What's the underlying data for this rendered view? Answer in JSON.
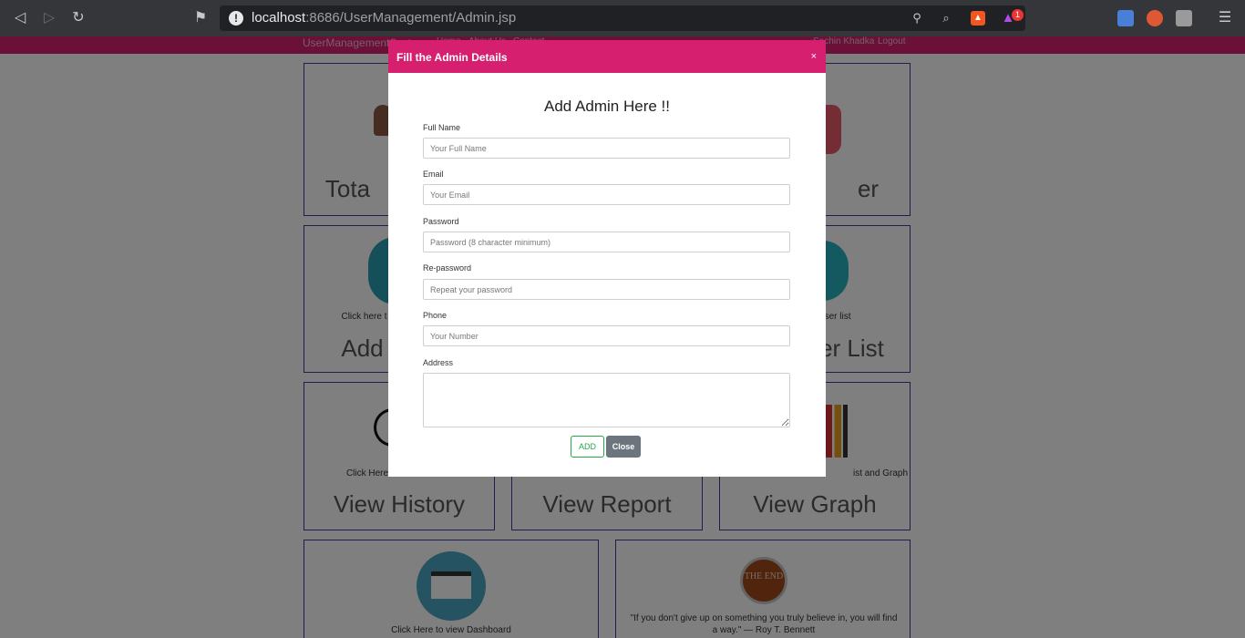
{
  "browser": {
    "url_host": "localhost",
    "url_path": ":8686/UserManagement/Admin.jsp",
    "rewards_badge": "1"
  },
  "navbar": {
    "brand": "UserManagementSystem",
    "links": [
      "Home",
      "About Us",
      "Contact"
    ],
    "user_name": "Sachin Khadka",
    "logout": "Logout"
  },
  "cards": {
    "total_title": "Tota",
    "user_title_fragment": "er",
    "add_sub": "Click here t",
    "add_title": "Add",
    "list_sub": "ew user list",
    "list_title": "er List",
    "history_sub": "Click Here",
    "history_title": "View History",
    "report_title": "View Report",
    "graph_sub": "ist and Graph",
    "graph_title": "View Graph",
    "dashboard_sub": "Click Here to view Dashboard",
    "end_badge": "THE END",
    "quote": "\"If you don't give up on something you truly believe in, you will find a way.\" — Roy T. Bennett"
  },
  "modal": {
    "title": "Fill the Admin Details",
    "close_x": "×",
    "heading": "Add Admin Here !!",
    "fields": {
      "full_name_label": "Full Name",
      "full_name_placeholder": "Your Full Name",
      "email_label": "Email",
      "email_placeholder": "Your Email",
      "password_label": "Password",
      "password_placeholder": "Password (8 character minimum)",
      "repassword_label": "Re-password",
      "repassword_placeholder": "Repeat your password",
      "phone_label": "Phone",
      "phone_placeholder": "Your Number",
      "address_label": "Address"
    },
    "add_button": "ADD",
    "close_button": "Close"
  },
  "colors": {
    "brand_pink": "#d6206f",
    "card_border": "#3a3f9e",
    "add_green": "#28a745",
    "close_gray": "#6c757d"
  }
}
